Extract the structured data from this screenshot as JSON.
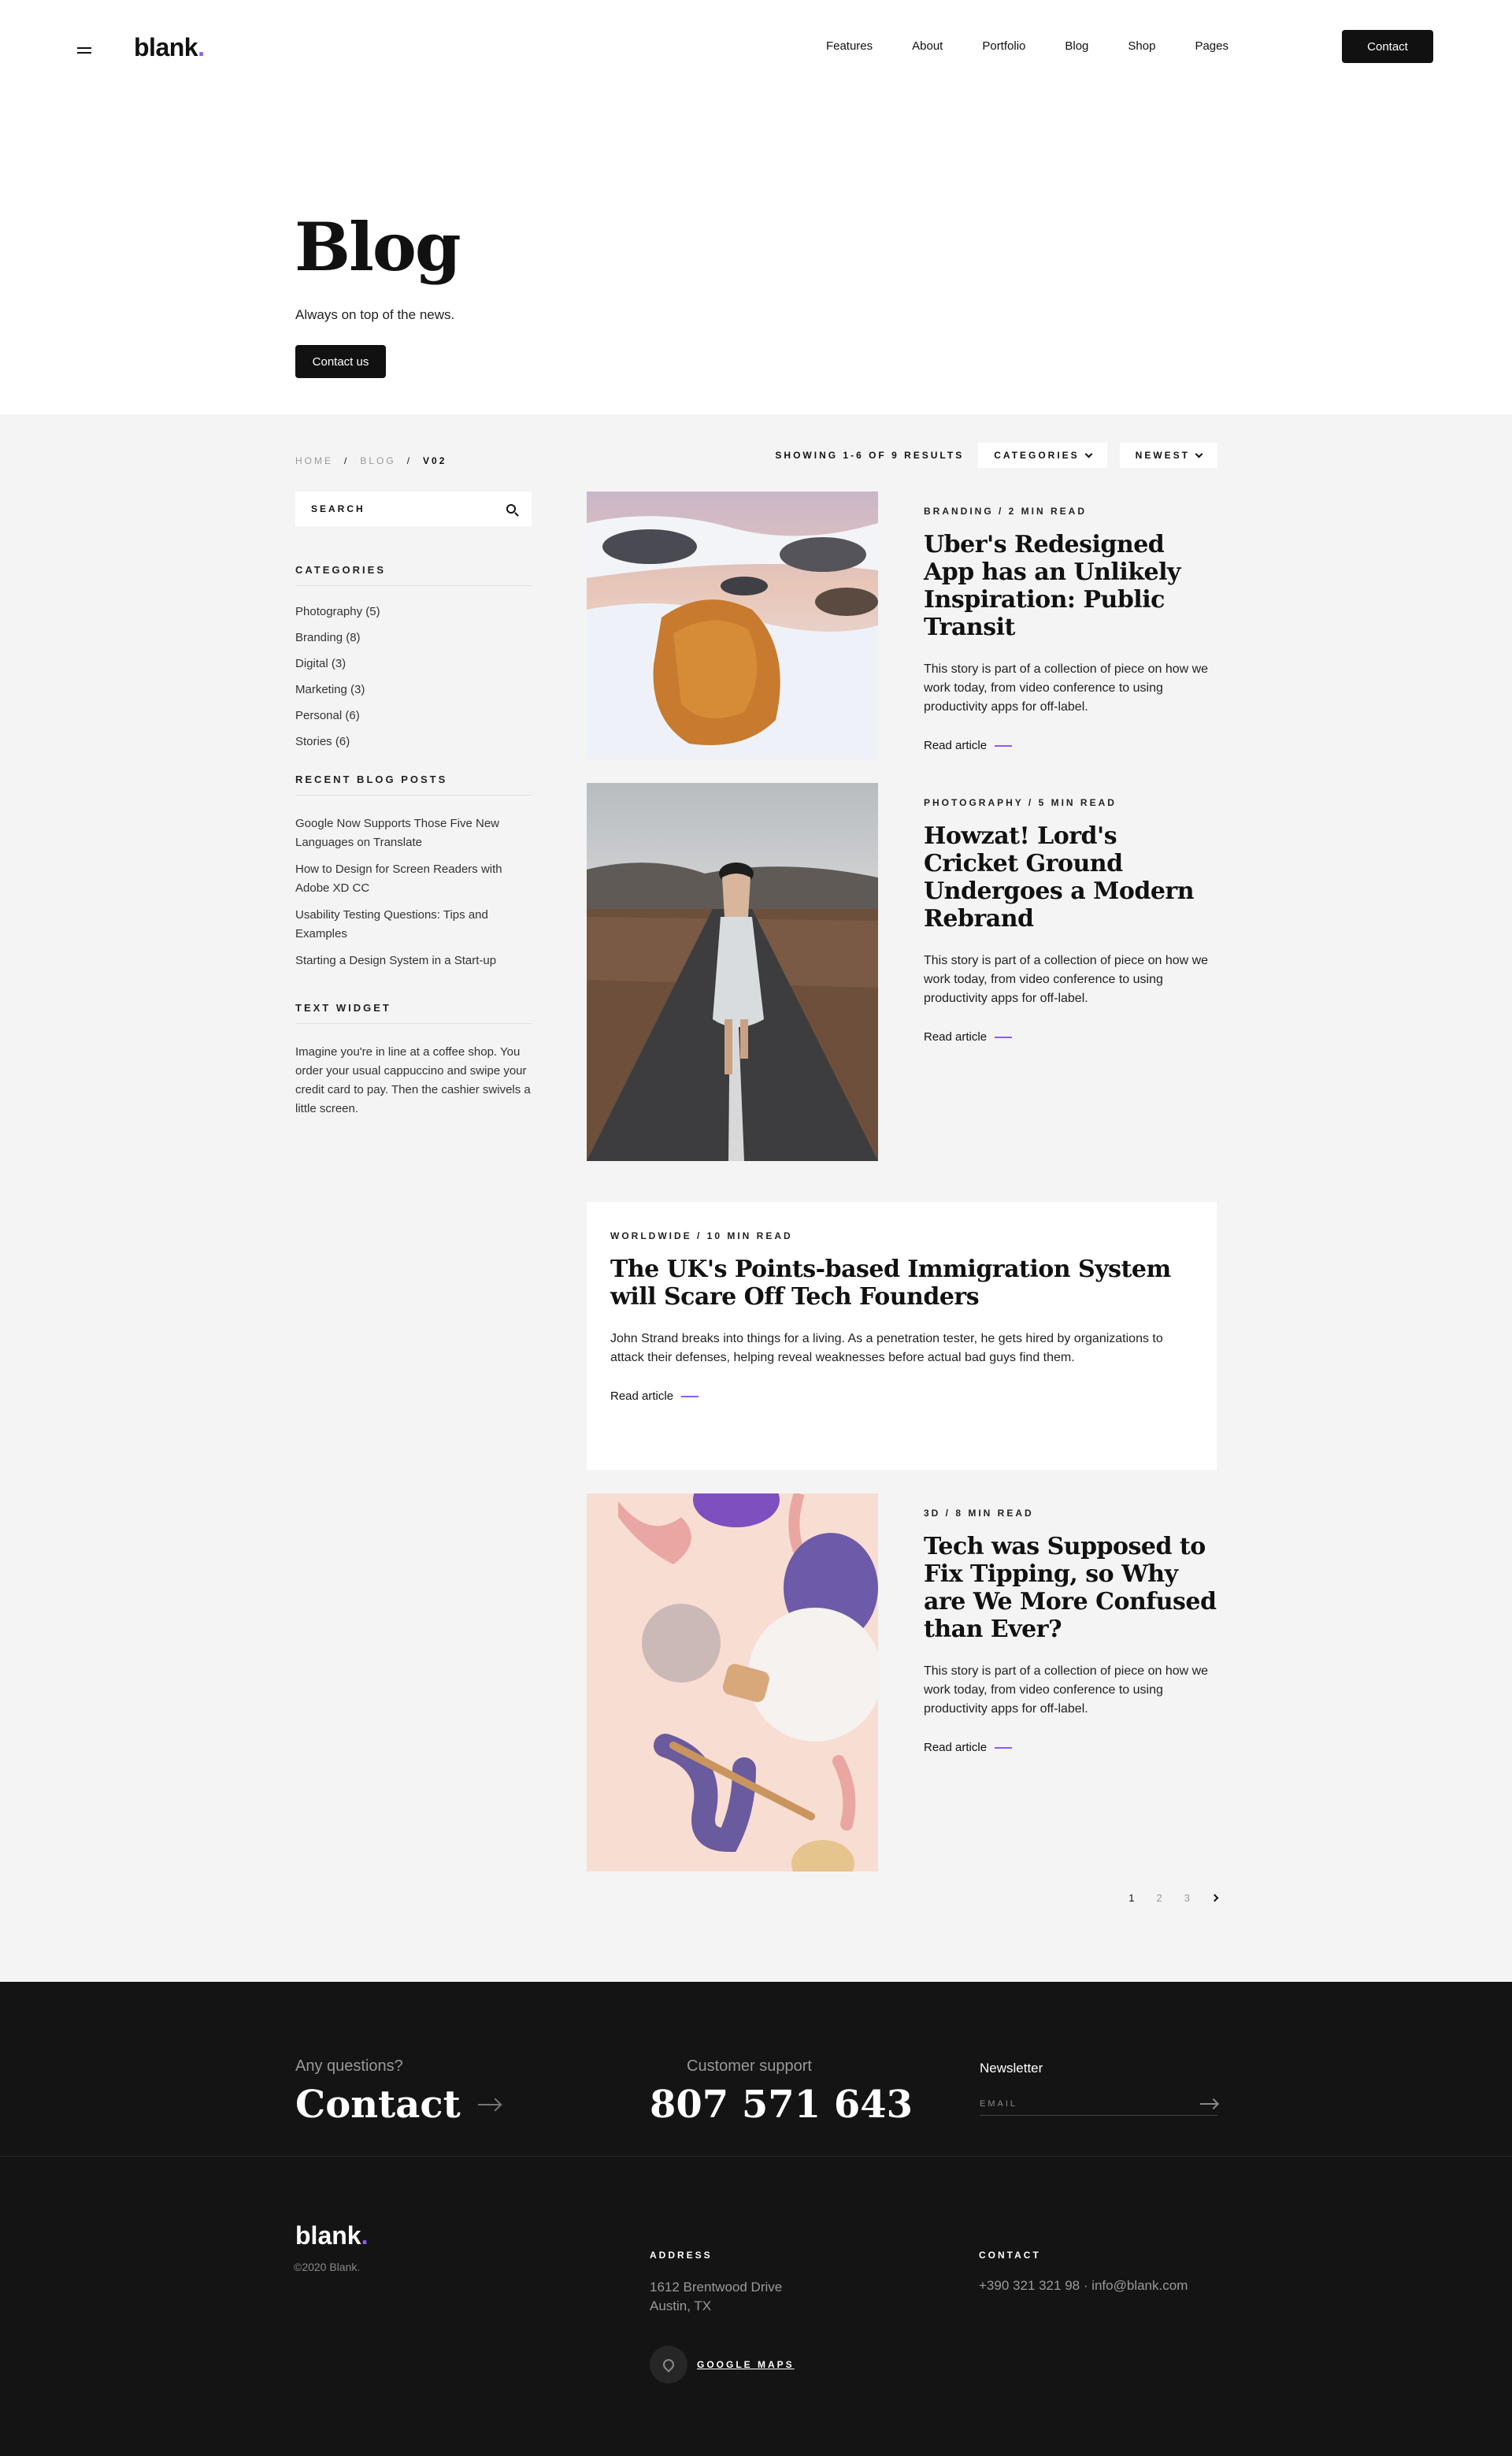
{
  "header": {
    "logo": "blank",
    "nav": [
      "Features",
      "About",
      "Portfolio",
      "Blog",
      "Shop",
      "Pages"
    ],
    "contact_label": "Contact"
  },
  "hero": {
    "title": "Blog",
    "subtitle": "Always on top of the news.",
    "button": "Contact us"
  },
  "breadcrumb": [
    "HOME",
    "BLOG",
    "V02"
  ],
  "toolbar": {
    "results": "SHOWING 1-6 OF 9 RESULTS",
    "categories": "CATEGORIES",
    "sort": "NEWEST"
  },
  "sidebar": {
    "search_placeholder": "SEARCH",
    "categories_heading": "CATEGORIES",
    "categories": [
      "Photography (5)",
      "Branding (8)",
      "Digital (3)",
      "Marketing (3)",
      "Personal (6)",
      "Stories (6)"
    ],
    "recent_heading": "RECENT BLOG POSTS",
    "recent": [
      "Google Now Supports Those Five New Languages on Translate",
      "How to Design for Screen Readers with Adobe XD CC",
      "Usability Testing Questions: Tips and Examples",
      "Starting a Design System in a Start-up"
    ],
    "widget_heading": "TEXT WIDGET",
    "widget_text": "Imagine you're in line at a coffee shop. You order your usual cappuccino and swipe your credit card to pay. Then the cashier swivels a little screen."
  },
  "posts": [
    {
      "meta": "BRANDING  /  2 MIN READ",
      "title": "Uber's Redesigned App has an Unlikely Inspiration: Public Transit",
      "excerpt": "This story is part of a collection of piece on how we work today, from video conference to using productivity apps for off-label.",
      "read": "Read article"
    },
    {
      "meta": "PHOTOGRAPHY  /  5 MIN READ",
      "title": "Howzat! Lord's Cricket Ground Undergoes a Modern Rebrand",
      "excerpt": "This story is part of a collection of piece on how we work today, from video conference to using productivity apps for off-label.",
      "read": "Read article"
    },
    {
      "meta": "WORLDWIDE  /  10 MIN READ",
      "title": "The UK's Points-based Immigration System will Scare Off Tech Founders",
      "excerpt": "John Strand breaks into things for a living. As a penetration tester, he gets hired by organizations to attack their defenses, helping reveal weaknesses before actual bad guys find them.",
      "read": "Read article"
    },
    {
      "meta": "3D  /  8 MIN READ",
      "title": "Tech was Supposed to Fix Tipping, so Why are We More Confused than Ever?",
      "excerpt": "This story is part of a collection of piece on how we work today, from video conference to using productivity apps for off-label.",
      "read": "Read article"
    }
  ],
  "pagination": [
    "1",
    "2",
    "3"
  ],
  "footer": {
    "question": "Any questions?",
    "contact": "Contact",
    "support_label": "Customer support",
    "phone": "807 571 643",
    "newsletter": "Newsletter",
    "email_placeholder": "EMAIL",
    "logo": "blank",
    "copyright": "©2020 Blank.",
    "address_heading": "ADDRESS",
    "address_line1": "1612  Brentwood Drive",
    "address_line2": "Austin, TX",
    "maps": "GOOGLE MAPS",
    "contact_heading": "CONTACT",
    "contact_line": "+390 321 321 98  ·  info@blank.com"
  },
  "colors": {
    "accent": "#8b5cf6",
    "dark": "#141414",
    "bg": "#f4f4f4"
  }
}
